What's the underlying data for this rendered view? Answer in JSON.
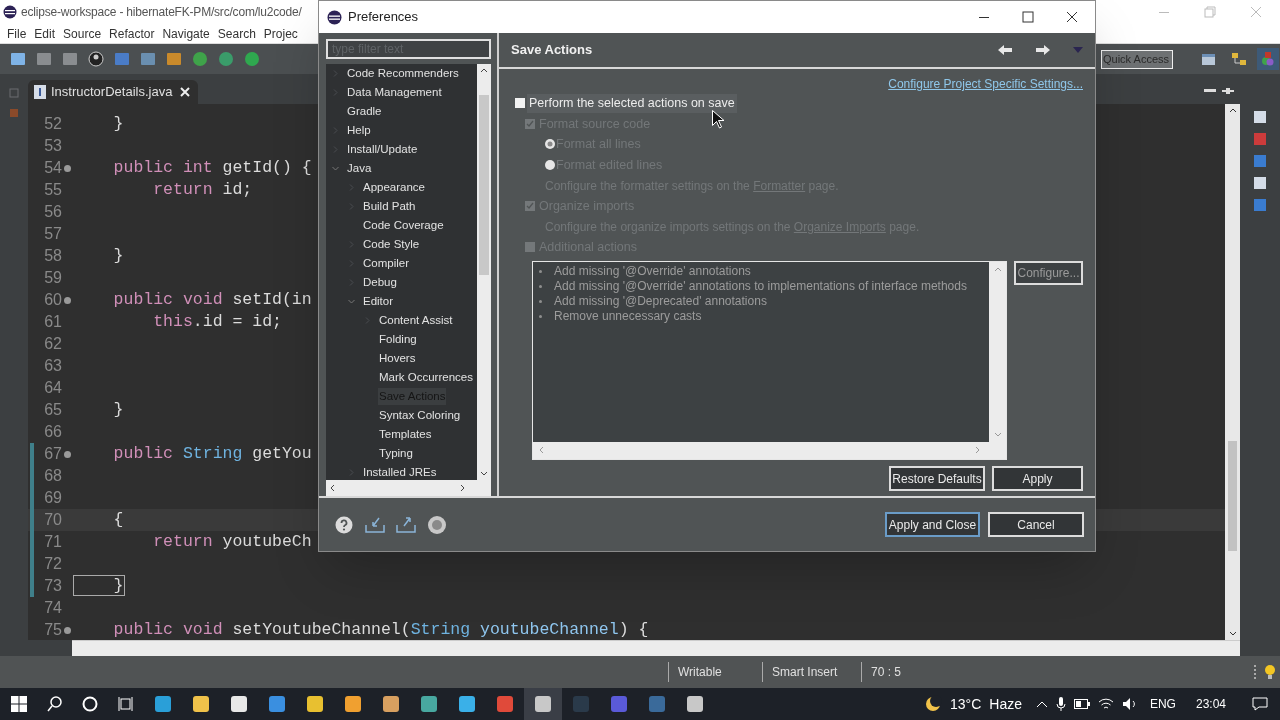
{
  "ide": {
    "title": "eclipse-workspace - hibernateFK-PM/src/com/lu2code/",
    "menu": [
      "File",
      "Edit",
      "Source",
      "Refactor",
      "Navigate",
      "Search",
      "Projec"
    ],
    "quick_access": {
      "placeholder": "Quick Access"
    },
    "editor_tab": {
      "label": "InstructorDetails.java"
    },
    "code_lines": [
      {
        "number": "52",
        "fold": false,
        "changed": false,
        "current": false,
        "segments": [
          {
            "text": "    }",
            "kind": "plain"
          }
        ]
      },
      {
        "number": "53",
        "fold": false,
        "changed": false,
        "current": false
      },
      {
        "number": "54",
        "fold": true,
        "changed": false,
        "current": false,
        "segments": [
          {
            "text": "    public",
            "kind": "keyword"
          },
          {
            "text": " int",
            "kind": "keyword"
          },
          {
            "text": " getId() {",
            "kind": "plain"
          }
        ]
      },
      {
        "number": "55",
        "fold": false,
        "changed": false,
        "current": false,
        "segments": [
          {
            "text": "        return",
            "kind": "keyword"
          },
          {
            "text": " id;",
            "kind": "plain"
          }
        ]
      },
      {
        "number": "56",
        "fold": false,
        "changed": false,
        "current": false
      },
      {
        "number": "57",
        "fold": false,
        "changed": false,
        "current": false
      },
      {
        "number": "58",
        "fold": false,
        "changed": false,
        "current": false,
        "segments": [
          {
            "text": "    }",
            "kind": "plain"
          }
        ]
      },
      {
        "number": "59",
        "fold": false,
        "changed": false,
        "current": false
      },
      {
        "number": "60",
        "fold": true,
        "changed": false,
        "current": false,
        "segments": [
          {
            "text": "    public",
            "kind": "keyword"
          },
          {
            "text": " void",
            "kind": "keyword"
          },
          {
            "text": " setId(in",
            "kind": "plain"
          }
        ]
      },
      {
        "number": "61",
        "fold": false,
        "changed": false,
        "current": false,
        "segments": [
          {
            "text": "        this",
            "kind": "keyword"
          },
          {
            "text": ".id = id;",
            "kind": "plain"
          }
        ]
      },
      {
        "number": "62",
        "fold": false,
        "changed": false,
        "current": false
      },
      {
        "number": "63",
        "fold": false,
        "changed": false,
        "current": false
      },
      {
        "number": "64",
        "fold": false,
        "changed": false,
        "current": false
      },
      {
        "number": "65",
        "fold": false,
        "changed": false,
        "current": false,
        "segments": [
          {
            "text": "    }",
            "kind": "plain"
          }
        ]
      },
      {
        "number": "66",
        "fold": false,
        "changed": false,
        "current": false
      },
      {
        "number": "67",
        "fold": true,
        "changed": true,
        "current": false,
        "segments": [
          {
            "text": "    public",
            "kind": "keyword"
          },
          {
            "text": " String",
            "kind": "type"
          },
          {
            "text": " getYou",
            "kind": "plain"
          }
        ]
      },
      {
        "number": "68",
        "fold": false,
        "changed": true,
        "current": false
      },
      {
        "number": "69",
        "fold": false,
        "changed": true,
        "current": false
      },
      {
        "number": "70",
        "fold": false,
        "changed": true,
        "current": true,
        "segments": [
          {
            "text": "    {",
            "kind": "plain"
          }
        ]
      },
      {
        "number": "71",
        "fold": false,
        "changed": true,
        "current": false,
        "segments": [
          {
            "text": "        return",
            "kind": "keyword"
          },
          {
            "text": " youtubeCh",
            "kind": "plain"
          }
        ]
      },
      {
        "number": "72",
        "fold": false,
        "changed": true,
        "current": false
      },
      {
        "number": "73",
        "fold": false,
        "changed": true,
        "current": false,
        "segments": [
          {
            "text": "    }",
            "kind": "bracket"
          }
        ]
      },
      {
        "number": "74",
        "fold": false,
        "changed": false,
        "current": false
      },
      {
        "number": "75",
        "fold": true,
        "changed": false,
        "current": false,
        "segments": [
          {
            "text": "    public",
            "kind": "keyword"
          },
          {
            "text": " void",
            "kind": "keyword"
          },
          {
            "text": " setYoutubeChannel(",
            "kind": "plain"
          },
          {
            "text": "String",
            "kind": "type"
          },
          {
            "text": " youtubeChannel",
            "kind": "param"
          },
          {
            "text": ") {",
            "kind": "plain"
          }
        ]
      }
    ],
    "status_bar": [
      "Writable",
      "Smart Insert",
      "70 : 5"
    ]
  },
  "taskbar": {
    "weather_temp": "13°C",
    "weather_text": "Haze",
    "language": "ENG",
    "time": "23:04"
  },
  "dialog": {
    "title": "Preferences",
    "filter": {
      "placeholder": "type filter text"
    },
    "tree": [
      {
        "label": "Code Recommenders",
        "expanded": false,
        "selected": false
      },
      {
        "label": "Data Management",
        "expanded": false,
        "selected": false
      },
      {
        "label": "Gradle",
        "selected": false
      },
      {
        "label": "Help",
        "expanded": false,
        "selected": false
      },
      {
        "label": "Install/Update",
        "expanded": false,
        "selected": false
      },
      {
        "label": "Java",
        "expanded": true,
        "selected": false,
        "children": [
          {
            "label": "Appearance",
            "expanded": false,
            "selected": false
          },
          {
            "label": "Build Path",
            "expanded": false,
            "selected": false
          },
          {
            "label": "Code Coverage",
            "selected": false
          },
          {
            "label": "Code Style",
            "expanded": false,
            "selected": false
          },
          {
            "label": "Compiler",
            "expanded": false,
            "selected": false
          },
          {
            "label": "Debug",
            "expanded": false,
            "selected": false
          },
          {
            "label": "Editor",
            "expanded": true,
            "selected": false,
            "children": [
              {
                "label": "Content Assist",
                "expanded": false,
                "selected": false
              },
              {
                "label": "Folding",
                "selected": false
              },
              {
                "label": "Hovers",
                "selected": false
              },
              {
                "label": "Mark Occurrences",
                "selected": false
              },
              {
                "label": "Save Actions",
                "selected": true
              },
              {
                "label": "Syntax Coloring",
                "selected": false
              },
              {
                "label": "Templates",
                "selected": false
              },
              {
                "label": "Typing",
                "selected": false
              }
            ]
          },
          {
            "label": "Installed JREs",
            "expanded": false,
            "selected": false
          }
        ]
      }
    ],
    "page": {
      "title": "Save Actions",
      "link": "Configure Project Specific Settings...",
      "options": [
        {
          "kind": "checkbox",
          "label": "Perform the selected actions on save",
          "checked": false,
          "disabled": false,
          "children": [
            {
              "kind": "checkbox",
              "label": "Format source code",
              "checked": true,
              "disabled": true,
              "children": [
                {
                  "kind": "radio",
                  "label": "Format all lines",
                  "selected": true,
                  "disabled": true
                },
                {
                  "kind": "radio",
                  "label": "Format edited lines",
                  "selected": false,
                  "disabled": true
                },
                {
                  "kind": "note",
                  "before": "Configure the formatter settings on the ",
                  "link": "Formatter",
                  "after": " page.",
                  "disabled": true
                }
              ]
            },
            {
              "kind": "checkbox",
              "label": "Organize imports",
              "checked": true,
              "disabled": true,
              "children": [
                {
                  "kind": "note",
                  "before": "Configure the organize imports settings on the ",
                  "link": "Organize Imports",
                  "after": " page.",
                  "disabled": true
                }
              ]
            },
            {
              "kind": "checkbox",
              "label": "Additional actions",
              "checked": false,
              "disabled": true
            }
          ]
        }
      ],
      "additional_actions": [
        "Add missing '@Override' annotations",
        "Add missing '@Override' annotations to implementations of interface methods",
        "Add missing '@Deprecated' annotations",
        "Remove unnecessary casts"
      ],
      "configure_button": "Configure...",
      "buttons": [
        "Restore Defaults",
        "Apply"
      ]
    },
    "footer_buttons": [
      {
        "label": "Apply and Close",
        "default": true
      },
      {
        "label": "Cancel",
        "default": false
      }
    ]
  }
}
